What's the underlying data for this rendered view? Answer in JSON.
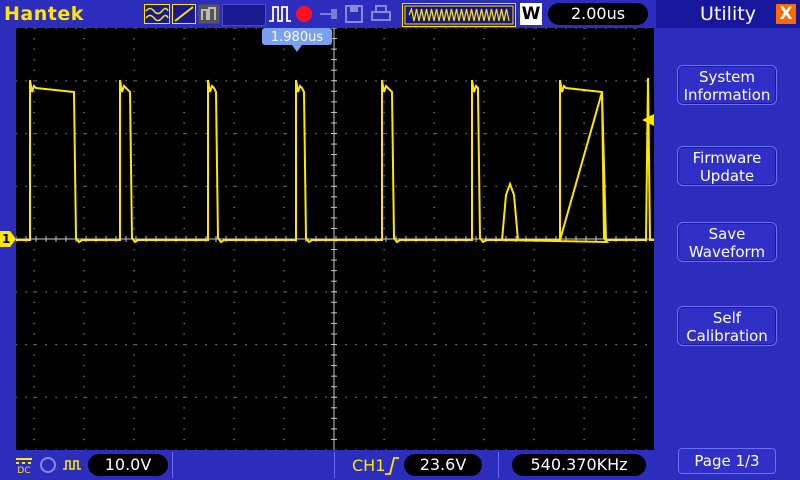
{
  "header": {
    "brand": "Hantek",
    "time_division": "2.00us",
    "window_label": "W",
    "cursor_readout": "1.980us"
  },
  "sidebar": {
    "title": "Utility",
    "close_glyph": "X",
    "items": [
      {
        "line1": "System",
        "line2": "Information"
      },
      {
        "line1": "Firmware",
        "line2": "Update"
      },
      {
        "line1": "Save",
        "line2": "Waveform"
      },
      {
        "line1": "Self",
        "line2": "Calibration"
      }
    ],
    "page": "Page 1/3"
  },
  "status": {
    "volts_per_div": "10.0V",
    "trigger_channel": "CH1",
    "trigger_level": "23.6V",
    "frequency": "540.370KHz",
    "channel_marker": "1"
  },
  "colors": {
    "trace": "#ffe600",
    "screen": "#000000",
    "frame": "#2d2dbd",
    "accent": "#ff6a00"
  }
}
